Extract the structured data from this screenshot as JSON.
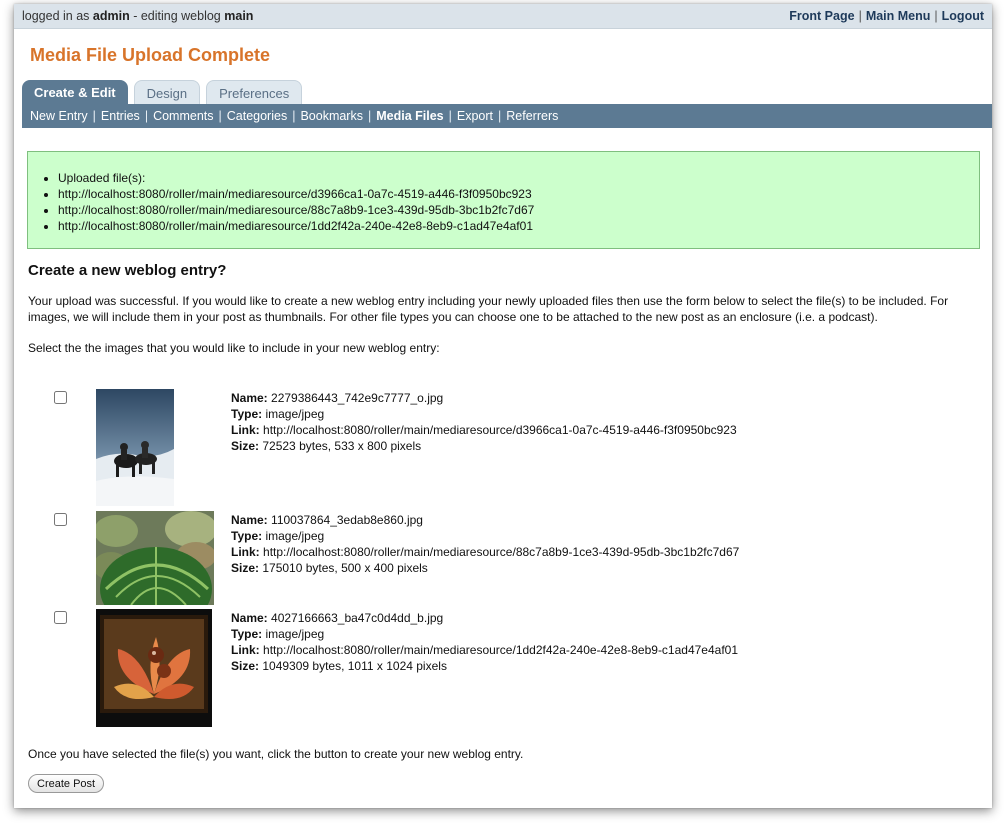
{
  "topbar": {
    "logged_prefix": "logged in as",
    "user": "admin",
    "editing_prefix": "- editing weblog",
    "weblog": "main",
    "links": [
      "Front Page",
      "Main Menu",
      "Logout"
    ]
  },
  "page_title": "Media File Upload Complete",
  "tabs": [
    "Create & Edit",
    "Design",
    "Preferences"
  ],
  "subnav": [
    "New Entry",
    "Entries",
    "Comments",
    "Categories",
    "Bookmarks",
    "Media Files",
    "Export",
    "Referrers"
  ],
  "success": {
    "heading": "Uploaded file(s):",
    "urls": [
      "http://localhost:8080/roller/main/mediaresource/d3966ca1-0a7c-4519-a446-f3f0950bc923",
      "http://localhost:8080/roller/main/mediaresource/88c7a8b9-1ce3-439d-95db-3bc1b2fc7d67",
      "http://localhost:8080/roller/main/mediaresource/1dd2f42a-240e-42e8-8eb9-c1ad47e4af01"
    ]
  },
  "section_heading": "Create a new weblog entry?",
  "intro_text": "Your upload was successful. If you would like to create a new weblog entry including your newly uploaded files then use the form below to select the file(s) to be included. For images, we will include them in your post as thumbnails. For other file types you can choose one to be attached to the new post as an enclosure (i.e. a podcast).",
  "select_text": "Select the the images that you would like to include in your new weblog entry:",
  "labels": {
    "name": "Name:",
    "type": "Type:",
    "link": "Link:",
    "size": "Size:"
  },
  "files": [
    {
      "name": "2279386443_742e9c7777_o.jpg",
      "type": "image/jpeg",
      "link": "http://localhost:8080/roller/main/mediaresource/d3966ca1-0a7c-4519-a446-f3f0950bc923",
      "size": "72523 bytes, 533 x 800 pixels"
    },
    {
      "name": "110037864_3edab8e860.jpg",
      "type": "image/jpeg",
      "link": "http://localhost:8080/roller/main/mediaresource/88c7a8b9-1ce3-439d-95db-3bc1b2fc7d67",
      "size": "175010 bytes, 500 x 400 pixels"
    },
    {
      "name": "4027166663_ba47c0d4dd_b.jpg",
      "type": "image/jpeg",
      "link": "http://localhost:8080/roller/main/mediaresource/1dd2f42a-240e-42e8-8eb9-c1ad47e4af01",
      "size": "1049309 bytes, 1011 x 1024 pixels"
    }
  ],
  "footer_text": "Once you have selected the file(s) you want, click the button to create your new weblog entry.",
  "create_button": "Create Post"
}
